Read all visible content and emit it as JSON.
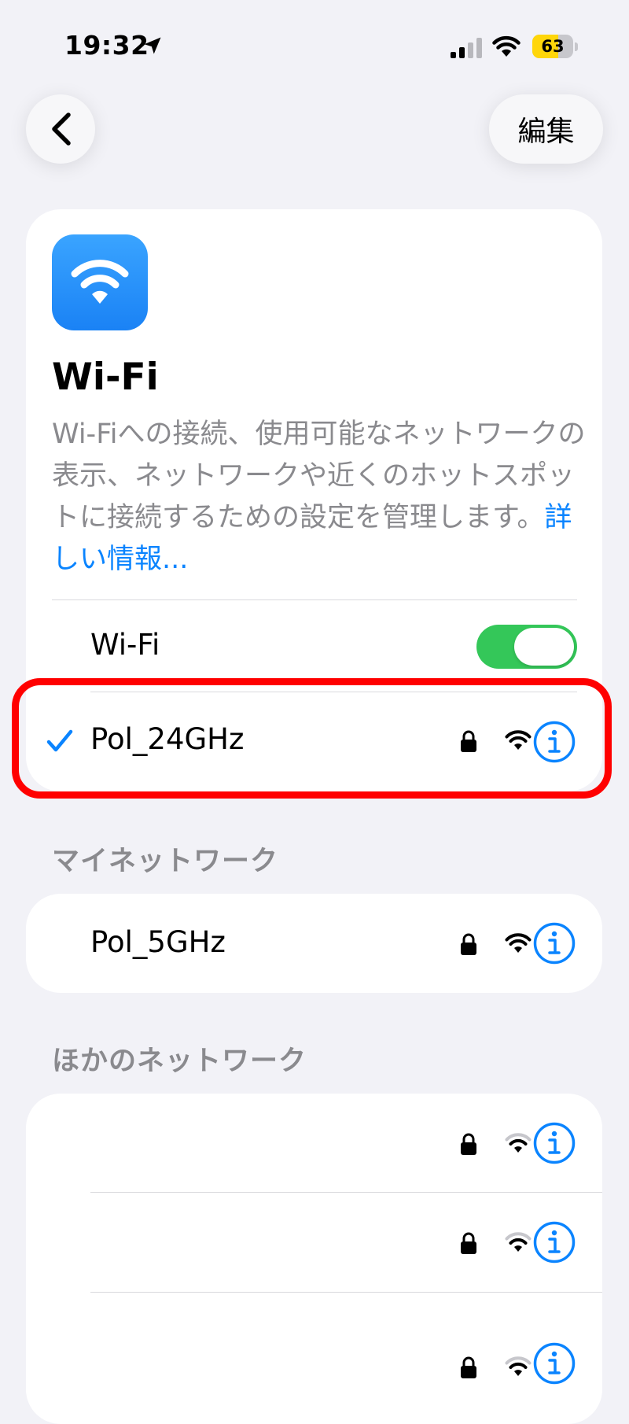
{
  "status_bar": {
    "time": "19:32",
    "battery_level": "63",
    "battery_percent": 63
  },
  "nav": {
    "edit_label": "編集"
  },
  "header_card": {
    "title": "Wi-Fi",
    "description": "Wi-Fiへの接続、使用可能なネットワークの表示、ネットワークや近くのホットスポットに接続するための設定を管理します。",
    "learn_more_link": "詳しい情報..."
  },
  "wifi_toggle": {
    "label": "Wi-Fi",
    "on": true
  },
  "connected_network": {
    "name": "Pol_24GHz"
  },
  "my_networks": {
    "header": "マイネットワーク",
    "items": [
      {
        "name": "Pol_5GHz"
      }
    ]
  },
  "other_networks": {
    "header": "ほかのネットワーク",
    "items": [
      {
        "name": ""
      },
      {
        "name": ""
      },
      {
        "name": ""
      }
    ]
  },
  "colors": {
    "accent": "#0a84ff",
    "toggle_on": "#34c759",
    "background": "#f2f2f7",
    "highlight": "#ff0000"
  }
}
